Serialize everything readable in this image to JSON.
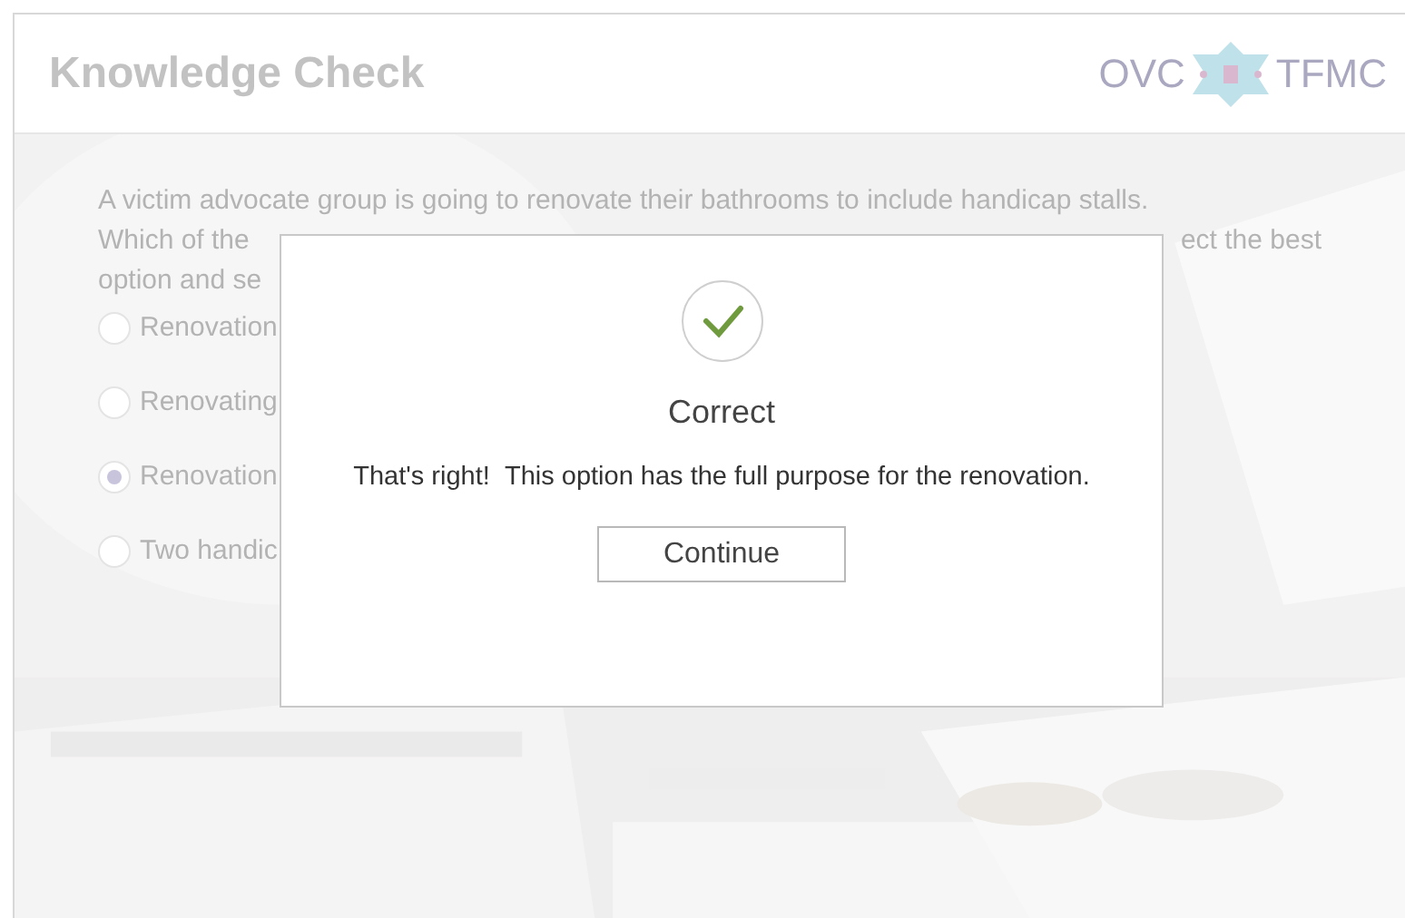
{
  "header": {
    "title": "Knowledge Check",
    "logo": {
      "left": "OVC",
      "right": "TFMC"
    }
  },
  "question": {
    "lines": [
      [
        "A victim advocate group is going to renovate their bathrooms to include handicap stalls."
      ],
      [
        "Which of the",
        "ect the best"
      ],
      [
        "option and se"
      ]
    ]
  },
  "options": [
    {
      "label": "Renovation",
      "selected": false
    },
    {
      "label": "Renovating",
      "selected": false
    },
    {
      "label": "Renovation",
      "selected": true
    },
    {
      "label": "Two handic",
      "selected": false
    }
  ],
  "dialog": {
    "title": "Correct",
    "message": "That's right!  This option has the full purpose for the renovation.",
    "button": "Continue"
  }
}
